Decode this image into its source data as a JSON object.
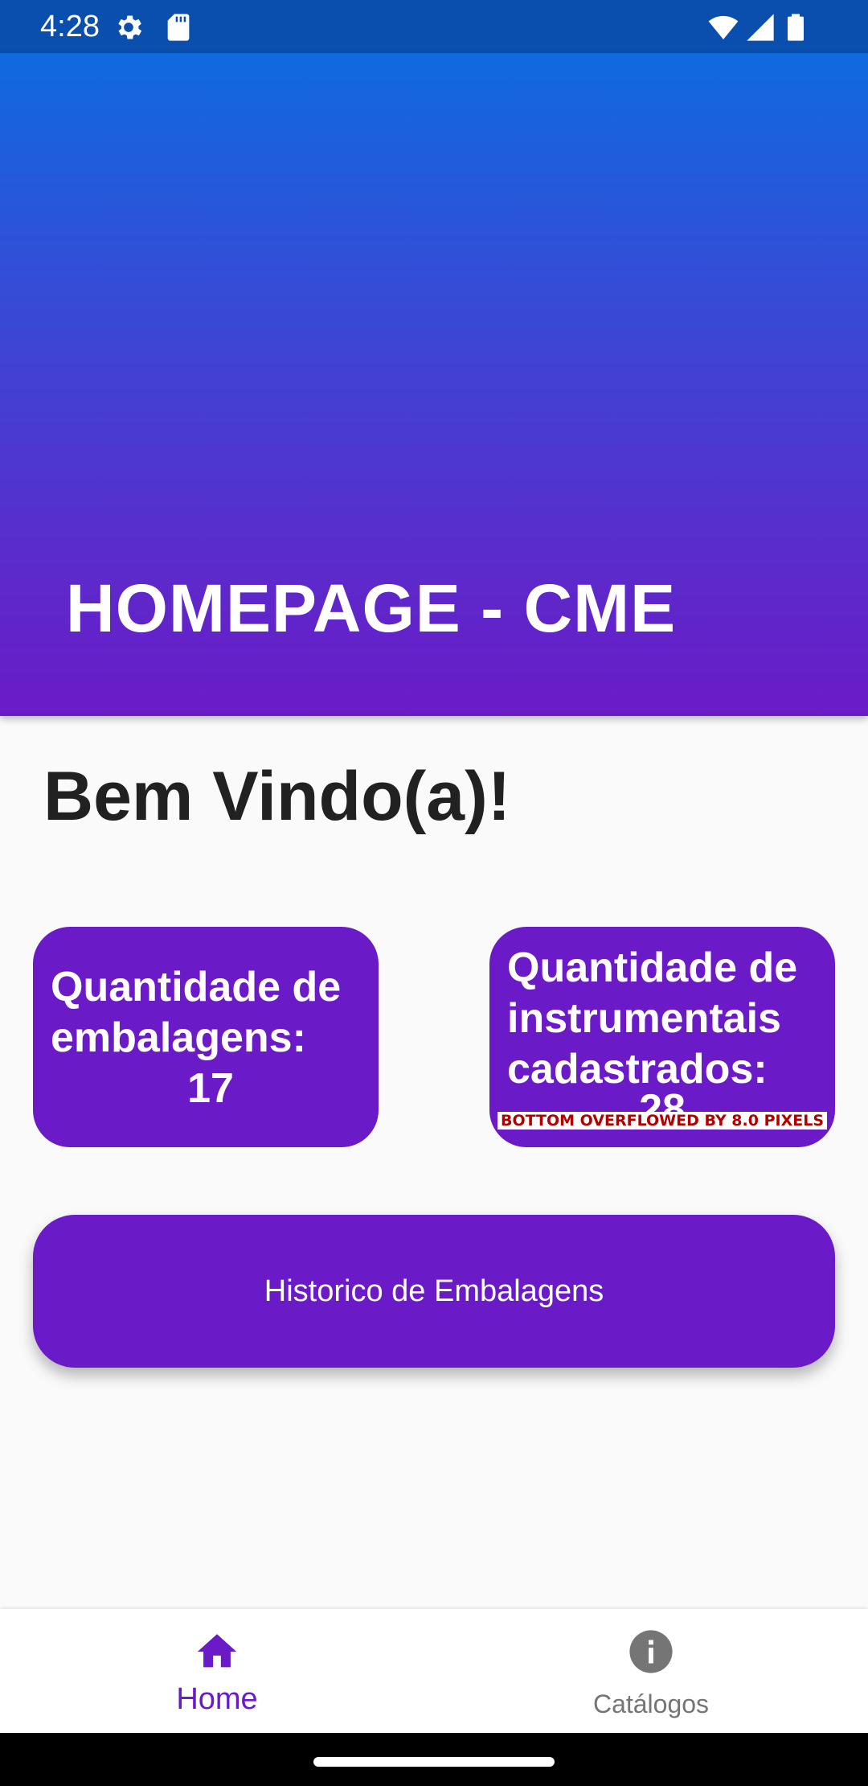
{
  "status_bar": {
    "time": "4:28",
    "icons": [
      "settings-gear-icon",
      "sd-card-icon",
      "wifi-icon",
      "signal-icon",
      "battery-icon"
    ]
  },
  "header": {
    "title": "HOMEPAGE - CME",
    "gradient_colors": [
      "#0f6ae0",
      "#6a1bc7"
    ]
  },
  "welcome": {
    "text": "Bem Vindo(a)!"
  },
  "cards": {
    "packages": {
      "label": "Quantidade de embalagens:",
      "value": "17"
    },
    "instruments": {
      "label": "Quantidade de instrumentais cadastrados:",
      "value": "28",
      "overflow_warning": "BOTTOM OVERFLOWED BY 8.0 PIXELS"
    }
  },
  "history_button": {
    "label": "Historico de Embalagens"
  },
  "bottom_nav": {
    "items": [
      {
        "label": "Home",
        "icon": "home-icon",
        "selected": true
      },
      {
        "label": "Catálogos",
        "icon": "info-icon",
        "selected": false
      }
    ]
  },
  "colors": {
    "accent": "#6a1bc7",
    "status_bar": "#0a4fae",
    "background": "#fafafa",
    "inactive_nav": "#757575"
  }
}
